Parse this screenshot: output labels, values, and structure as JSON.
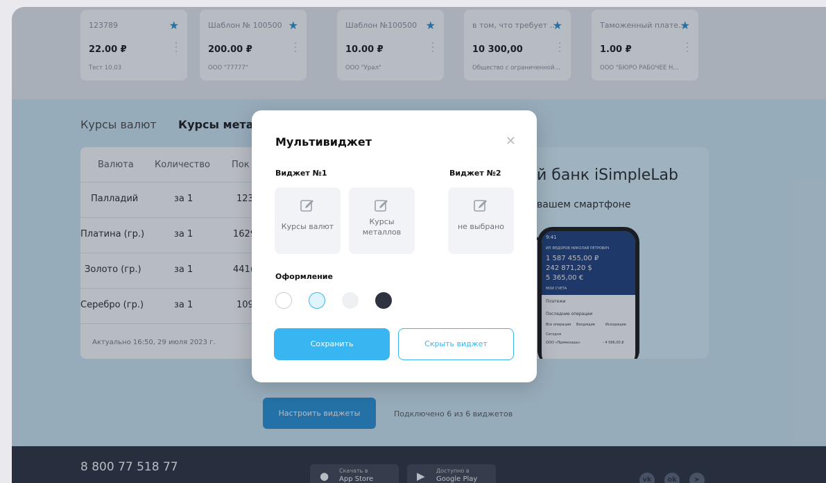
{
  "templates": [
    {
      "name": "123789",
      "amount": "22.00 ₽",
      "sub": "Тест 10.03"
    },
    {
      "name": "Шаблон № 100500",
      "amount": "200.00 ₽",
      "sub": "ООО \"77777\""
    },
    {
      "name": "Шаблон №100500",
      "amount": "10.00 ₽",
      "sub": "ООО \"Урал\""
    },
    {
      "name": "в том, что требует …",
      "amount": "10 300,00",
      "sub": "Общество с ограниченной…"
    },
    {
      "name": "Таможенный плате…",
      "amount": "1.00 ₽",
      "sub": "ООО \"БЮРО РАБОЧЕЕ Н…"
    }
  ],
  "tabs": {
    "currency": "Курсы валют",
    "metals": "Курсы метал"
  },
  "rates": {
    "headers": [
      "Валюта",
      "Количество",
      "Пок"
    ],
    "rows": [
      {
        "name": "Палладий",
        "qty": "за 1",
        "buy": "123"
      },
      {
        "name": "Платина (гр.)",
        "qty": "за 1",
        "buy": "1629"
      },
      {
        "name": "Золото (гр.)",
        "qty": "за 1",
        "buy": "441("
      },
      {
        "name": "Серебро (гр.)",
        "qty": "за 1",
        "buy": "109"
      }
    ],
    "note": "Актуально 16:50, 29 июля 2023 г."
  },
  "promo": {
    "title": "й банк iSimpleLab",
    "subtitle": "вашем смартфоне",
    "phone": {
      "time": "9:41",
      "client": "ИП ФЕДОРОВ НИКОЛАЙ ПЕТРОВИЧ",
      "bal1": "1 587 455,00 ₽",
      "bal2": "242 871,20 $",
      "bal3": "5 365,00 €",
      "accounts": "МОИ СЧЕТА",
      "payments": "Платежи",
      "recent": "Последние операции",
      "tab_all": "Все операции",
      "tab_in": "Входящие",
      "tab_out": "Исходящие",
      "today": "Сегодня",
      "op_name": "ООО «Примехашь»",
      "op_amount": "- 4 566,00 ₽"
    }
  },
  "cta": {
    "label": "Настроить виджеты",
    "note": "Подключено 6 из 6 виджетов"
  },
  "footer": {
    "phone": "8 800 77 518 77",
    "appstore": {
      "line1": "Скачать в",
      "line2": "App Store"
    },
    "googleplay": {
      "line1": "Доступно в",
      "line2": "Google Play"
    },
    "social": [
      "vk",
      "ok",
      "telegram"
    ]
  },
  "modal": {
    "title": "Мультивиджет",
    "widget1_label": "Виджет №1",
    "widget2_label": "Виджет №2",
    "tiles": [
      {
        "label": "Курсы валют",
        "icon": "edit-icon"
      },
      {
        "label": "Курсы металлов",
        "icon": "edit-icon"
      },
      {
        "label": "не выбрано",
        "icon": "edit-icon"
      }
    ],
    "design_label": "Оформление",
    "swatches": [
      {
        "color": "#ffffff",
        "border": "#c9ccd2"
      },
      {
        "color": "#dff4fc",
        "border": "#38b6f1"
      },
      {
        "color": "#eef0f4",
        "border": "#eef0f4"
      },
      {
        "color": "#2f3341",
        "border": "#2f3341"
      }
    ],
    "save_label": "Сохранить",
    "hide_label": "Скрыть виджет"
  },
  "colors": {
    "accent": "#38b6f1",
    "primary": "#1f8fd6",
    "footer": "#252a36"
  }
}
